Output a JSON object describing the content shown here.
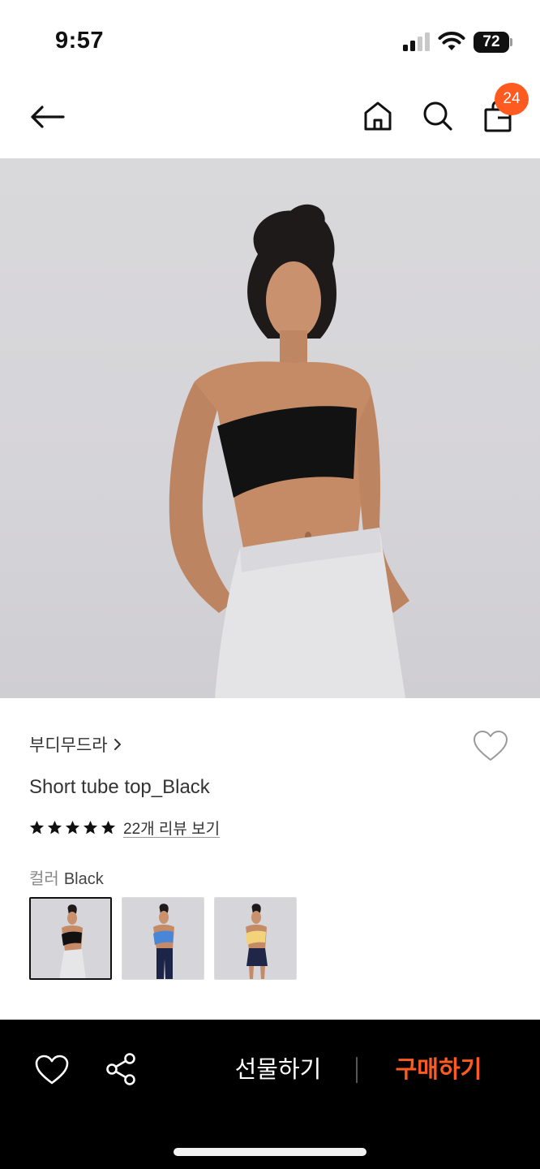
{
  "status_bar": {
    "time": "9:57",
    "battery": "72"
  },
  "nav": {
    "cart_count": "24",
    "icons": [
      "back-arrow-icon",
      "home-icon",
      "search-icon",
      "shopping-bag-icon"
    ]
  },
  "product": {
    "brand": "부디무드라",
    "title": "Short tube top_Black",
    "rating": 5,
    "review_link": "22개 리뷰 보기",
    "color_label": "컬러",
    "color_value": "Black",
    "swatches": [
      {
        "color": "Black",
        "top_hex": "#111111",
        "bottom_hex": "#e6e6e8"
      },
      {
        "color": "Blue",
        "top_hex": "#4a86d8",
        "bottom_hex": "#1c2447"
      },
      {
        "color": "Yellow",
        "top_hex": "#f2d27a",
        "bottom_hex": "#1f2647"
      }
    ]
  },
  "bottom_bar": {
    "gift_label": "선물하기",
    "buy_label": "구매하기"
  },
  "colors": {
    "accent": "#ff5a1f",
    "bottom_bar_bg": "#000000"
  }
}
